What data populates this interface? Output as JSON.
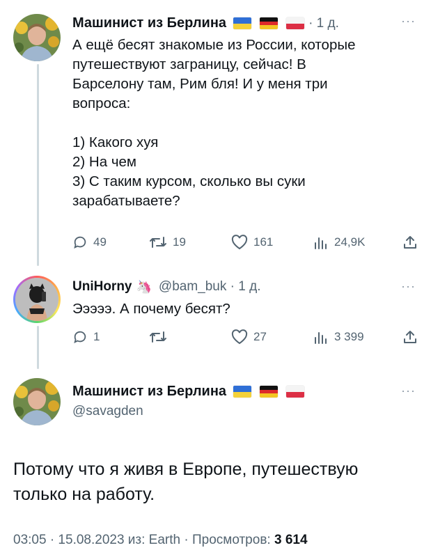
{
  "tweet1": {
    "author_name": "Машинист из Берлина",
    "flags": [
      "ukraine-flag",
      "germany-flag",
      "poland-flag"
    ],
    "time": "· 1 д.",
    "more": "···",
    "text": "А ещё бесят знакомые из России, которые\nпутешествуют заграницу, сейчас! В\nБарселону там, Рим бля! И у меня три\nвопроса:\n\n1) Какого хуя\n2) На чем\n3) С таким курсом, сколько вы суки\nзарабатываете?",
    "replies": "49",
    "retweets": "19",
    "likes": "161",
    "views": "24,9K"
  },
  "tweet2": {
    "author_name": "UniHorny",
    "emoji": "🦄",
    "handle_time": "@bam_buk · 1 д.",
    "more": "···",
    "text": "Эээээ. А почему бесят?",
    "replies": "1",
    "retweets": "",
    "likes": "27",
    "views": "3 399"
  },
  "tweet3": {
    "author_name": "Машинист из Берлина",
    "flags": [
      "ukraine-flag",
      "germany-flag",
      "poland-flag"
    ],
    "handle": "@savagden",
    "more": "···",
    "text": "Потому что я живя в Европе, путешествую\nтолько на работу.",
    "footer_meta": "03:05 · 15.08.2023 из: Earth · Просмотров: ",
    "views": "3 614"
  },
  "colors": {
    "text": "#0f1419",
    "secondary": "#536471",
    "thread_line": "#cfd9de"
  }
}
